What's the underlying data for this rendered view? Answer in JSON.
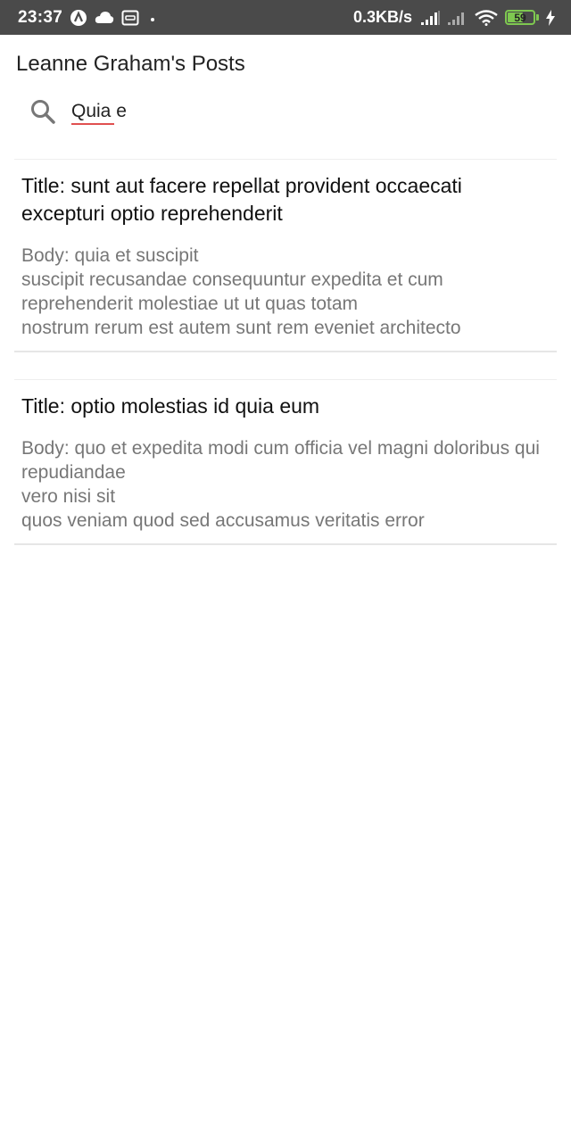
{
  "status_bar": {
    "time": "23:37",
    "network_speed": "0.3KB/s",
    "battery_level": "59",
    "icons": [
      "app-a-icon",
      "cloud-icon",
      "screen-record-icon",
      "dot-icon",
      "signal-1-icon",
      "signal-2-icon",
      "wifi-icon",
      "battery-icon",
      "charging-icon"
    ]
  },
  "header": {
    "title": "Leanne Graham's Posts"
  },
  "search": {
    "value": "Quia e",
    "icon": "search-icon"
  },
  "posts": [
    {
      "title": "Title: sunt aut facere repellat provident occaecati excepturi optio reprehenderit",
      "body": "Body: quia et suscipit\nsuscipit recusandae consequuntur expedita et cum reprehenderit molestiae ut ut quas totam\nnostrum rerum est autem sunt rem eveniet architecto"
    },
    {
      "title": "Title: optio molestias id quia eum",
      "body": "Body: quo et expedita modi cum officia vel magni doloribus qui repudiandae\nvero nisi sit\nquos veniam quod sed accusamus veritatis error"
    }
  ],
  "colors": {
    "status_bar_bg": "#4a4a4a",
    "battery": "#7ec850",
    "title_text": "#111111",
    "body_text": "#777777",
    "spellcheck": "#e05050"
  }
}
